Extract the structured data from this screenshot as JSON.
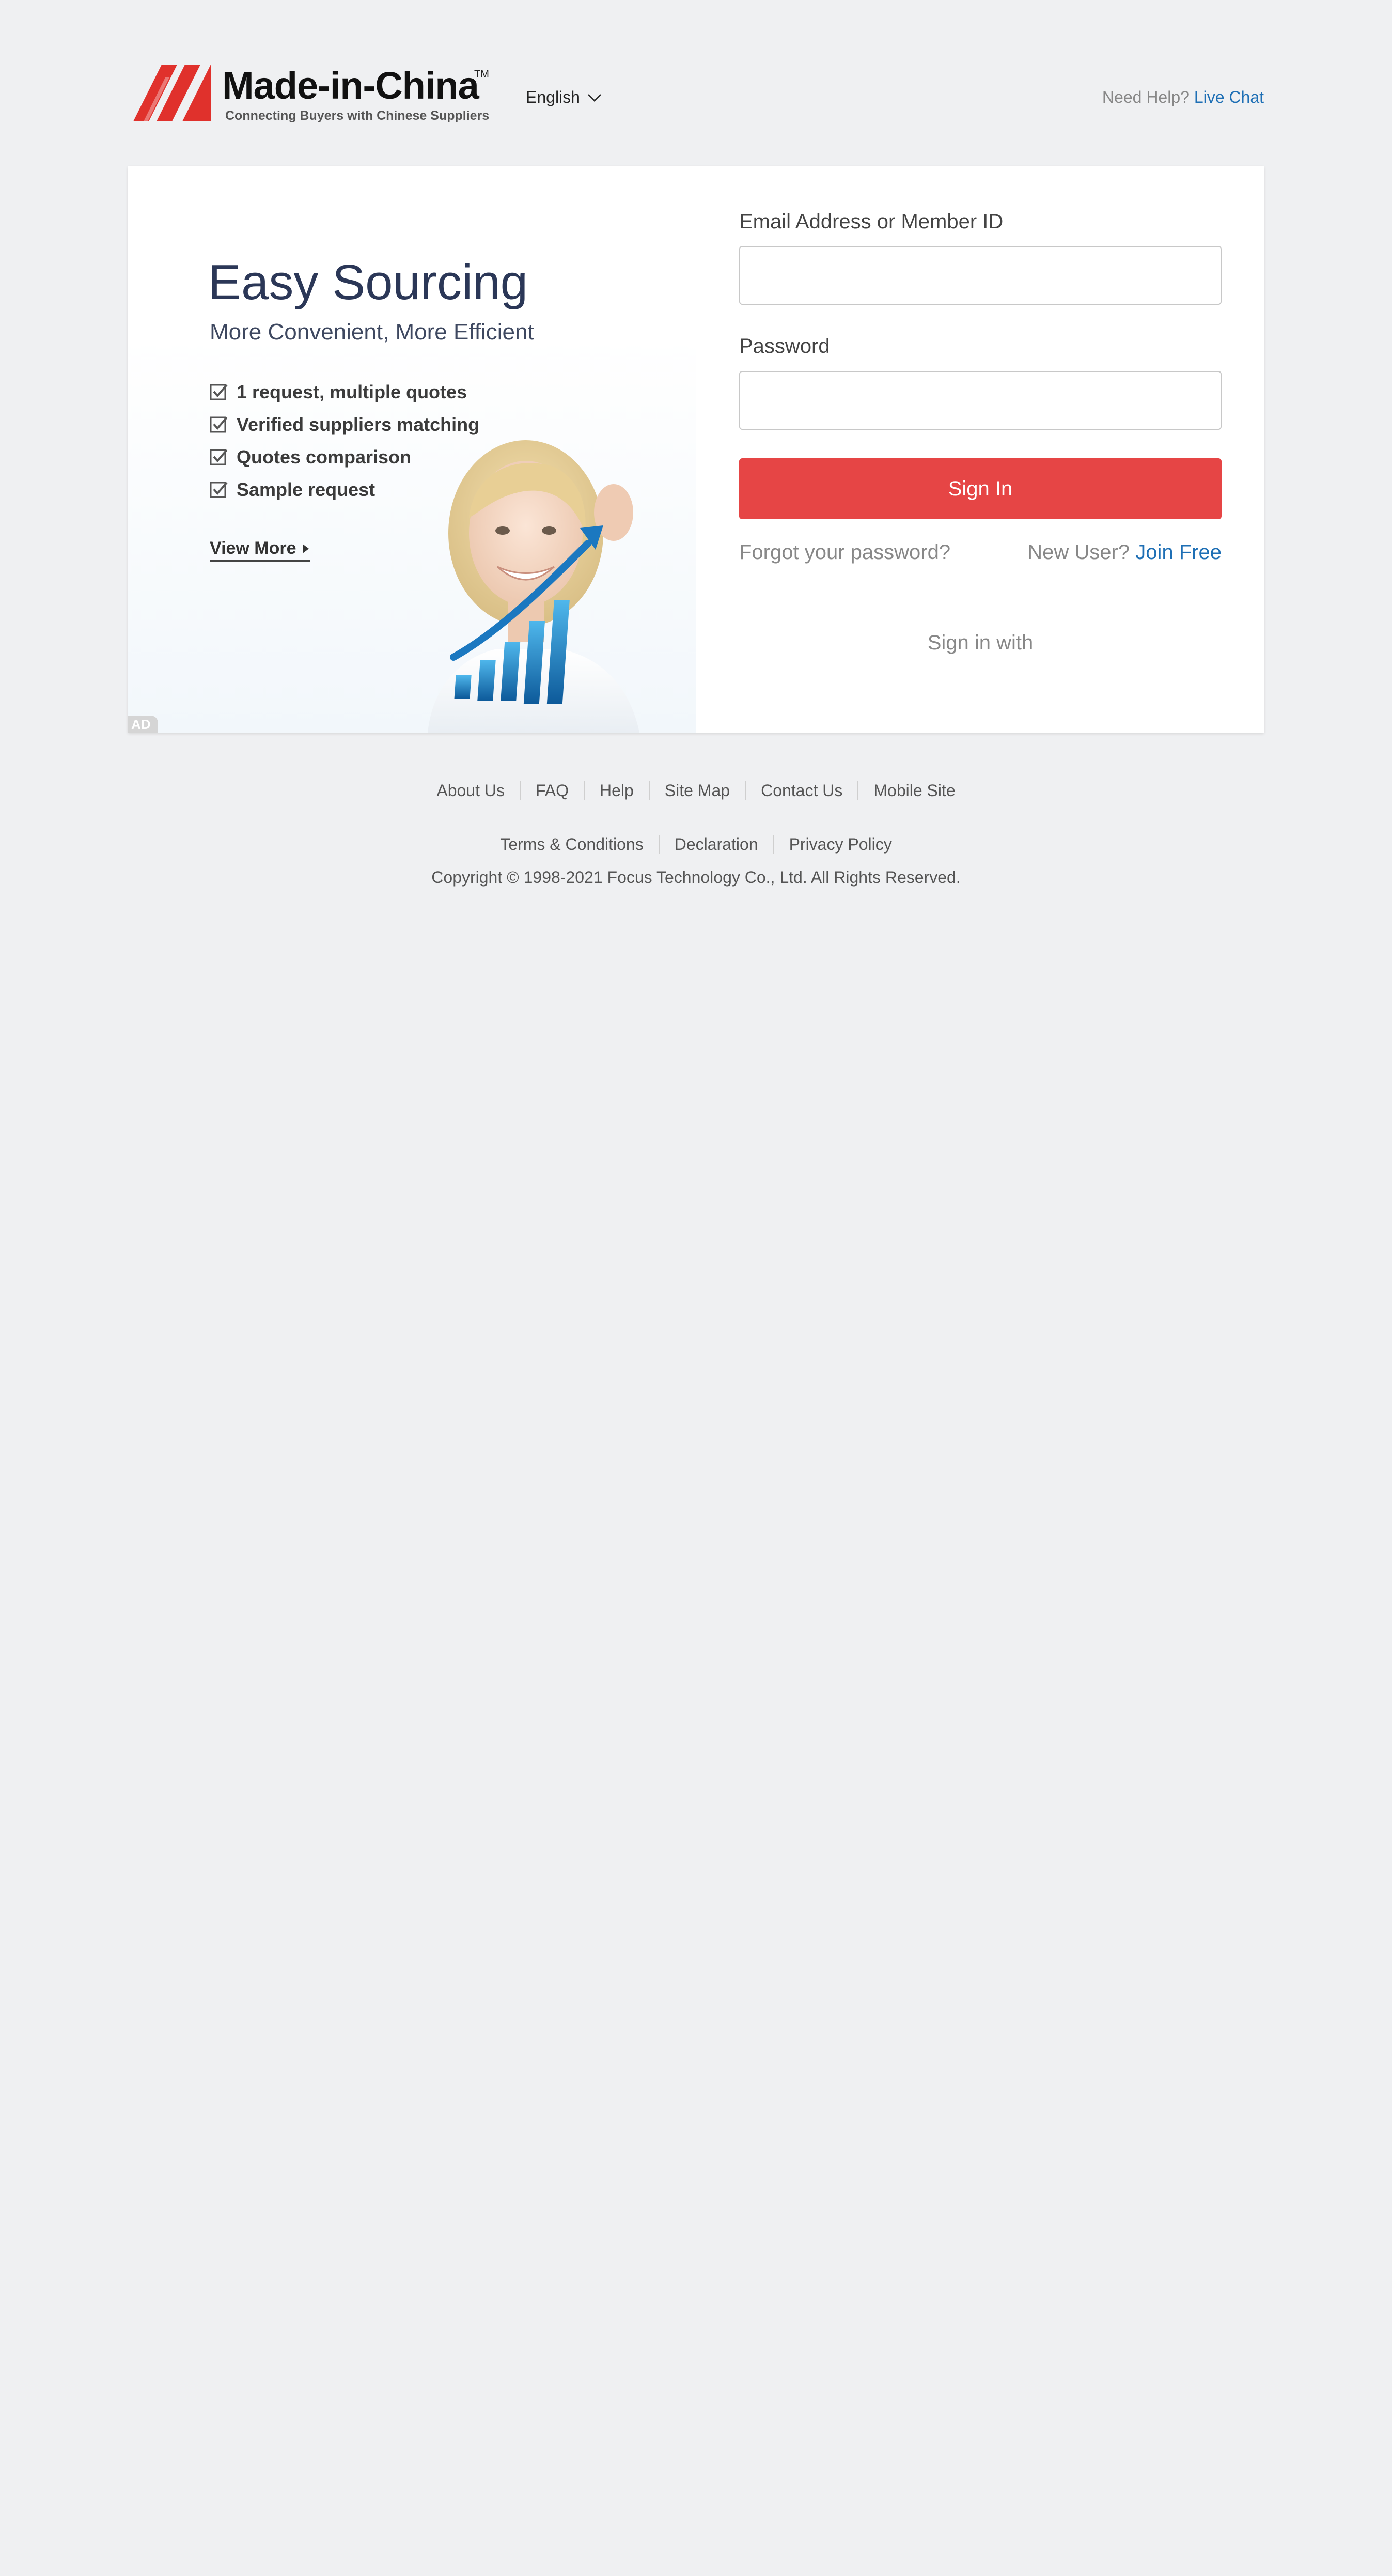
{
  "header": {
    "logo_text": "Made-in-China",
    "logo_tm": "TM",
    "logo_tagline": "Connecting Buyers with Chinese Suppliers",
    "language": "English",
    "help_prefix": "Need Help?",
    "help_link": "Live Chat"
  },
  "ad": {
    "title": "Easy Sourcing",
    "subtitle": "More Convenient, More Efficient",
    "features": [
      "1 request, multiple quotes",
      "Verified suppliers matching",
      "Quotes comparison",
      "Sample request"
    ],
    "view_more": "View More",
    "badge": "AD"
  },
  "form": {
    "email_label": "Email Address or Member ID",
    "email_value": "",
    "password_label": "Password",
    "password_value": "",
    "signin_button": "Sign In",
    "forgot_link": "Forgot your password?",
    "new_user_prefix": "New User?",
    "join_link": "Join Free",
    "signin_with": "Sign in with"
  },
  "footer": {
    "row1": [
      "About Us",
      "FAQ",
      "Help",
      "Site Map",
      "Contact Us",
      "Mobile Site"
    ],
    "row2": [
      "Terms & Conditions",
      "Declaration",
      "Privacy Policy"
    ],
    "copyright": "Copyright © 1998-2021 Focus Technology Co., Ltd. All Rights Reserved."
  },
  "colors": {
    "background": "#eff0f2",
    "accent_red": "#e64545",
    "link_blue": "#1e6fb5",
    "logo_red": "#e0312c"
  },
  "icons": {
    "language_dropdown": "chevron-down-icon",
    "feature_check": "checkbox-checked-icon",
    "view_more_arrow": "triangle-right-icon"
  }
}
